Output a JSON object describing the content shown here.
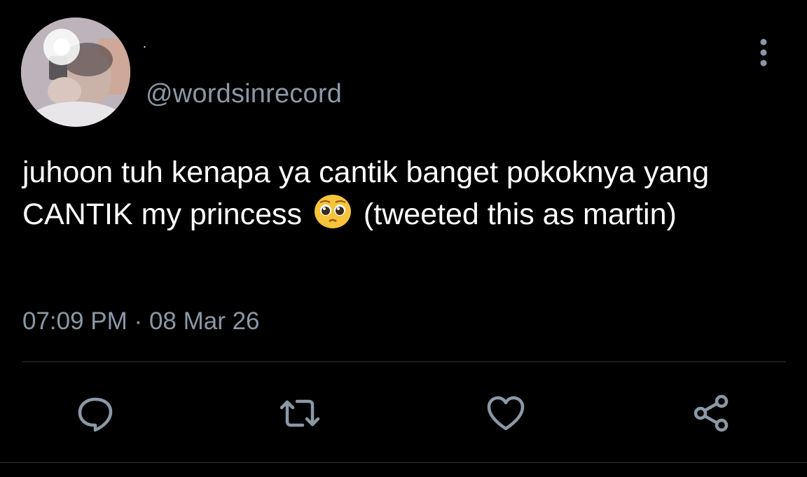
{
  "tweet": {
    "display_name": ".",
    "handle": "@wordsinrecord",
    "text_before_emoji": "juhoon tuh kenapa ya cantik banget pokoknya yang CANTIK my princess",
    "text_after_emoji": "(tweeted this as martin)",
    "emoji": "pleading-face-emoji",
    "time": "07:09 PM",
    "separator": "·",
    "date": "08 Mar 26"
  },
  "actions": [
    {
      "name": "reply",
      "icon": "speech-bubble-icon"
    },
    {
      "name": "retweet",
      "icon": "retweet-icon"
    },
    {
      "name": "like",
      "icon": "heart-icon"
    },
    {
      "name": "share",
      "icon": "share-icon"
    }
  ],
  "colors": {
    "background": "#000000",
    "text": "#ffffff",
    "secondary_text": "#8b98a5",
    "divider": "#2f3336"
  }
}
